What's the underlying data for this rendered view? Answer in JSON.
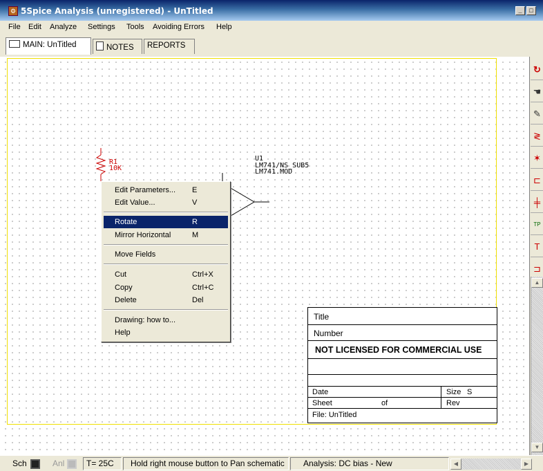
{
  "window": {
    "title": "5Spice Analysis (unregistered) - UnTitled",
    "minimize": "_",
    "maximize": "□"
  },
  "menubar": [
    "File",
    "Edit",
    "Analyze",
    "Settings",
    "Tools",
    "Avoiding Errors",
    "Help"
  ],
  "tabs": [
    {
      "label": "MAIN: UnTitled",
      "active": true
    },
    {
      "label": "NOTES",
      "active": false
    },
    {
      "label": "REPORTS",
      "active": false
    }
  ],
  "schematic": {
    "resistor": {
      "ref": "R1",
      "value": "10K",
      "color": "#cc0000"
    },
    "opamp": {
      "ref": "U1",
      "model_line1": "LM741/NS_SUB5",
      "model_line2": "LM741.MOD"
    }
  },
  "context_menu": {
    "items": [
      {
        "label": "Edit Parameters...",
        "shortcut": "E"
      },
      {
        "label": "Edit Value...",
        "shortcut": "V"
      },
      {
        "label": "Rotate",
        "shortcut": "R"
      },
      {
        "label": "Mirror Horizontal",
        "shortcut": "M"
      },
      {
        "label": "Move Fields",
        "shortcut": ""
      },
      {
        "label": "Cut",
        "shortcut": "Ctrl+X"
      },
      {
        "label": "Copy",
        "shortcut": "Ctrl+C"
      },
      {
        "label": "Delete",
        "shortcut": "Del"
      },
      {
        "label": "Drawing: how to...",
        "shortcut": ""
      },
      {
        "label": "Help",
        "shortcut": ""
      }
    ],
    "highlighted": "Rotate"
  },
  "title_block": {
    "title": "Title",
    "number": "Number",
    "license": "NOT LICENSED FOR COMMERCIAL USE",
    "date": "Date",
    "size_label": "Size",
    "size_value": "S",
    "sheet": "Sheet",
    "of": "of",
    "rev": "Rev",
    "file": "File: UnTitled"
  },
  "toolbar_icons": [
    "refresh-icon",
    "hand-icon",
    "pencil-icon",
    "resistor-icon",
    "diode-icon",
    "transistor-icon",
    "capacitor-icon",
    "testpoint-icon",
    "text-icon",
    "gate-icon"
  ],
  "toolbar_text": {
    "testpoint": "TP",
    "text": "T"
  },
  "statusbar": {
    "sch": "Sch",
    "anl": "Anl",
    "temperature": "T= 25C",
    "hint": "Hold right mouse button to Pan schematic",
    "analysis": "Analysis: DC bias - New"
  }
}
